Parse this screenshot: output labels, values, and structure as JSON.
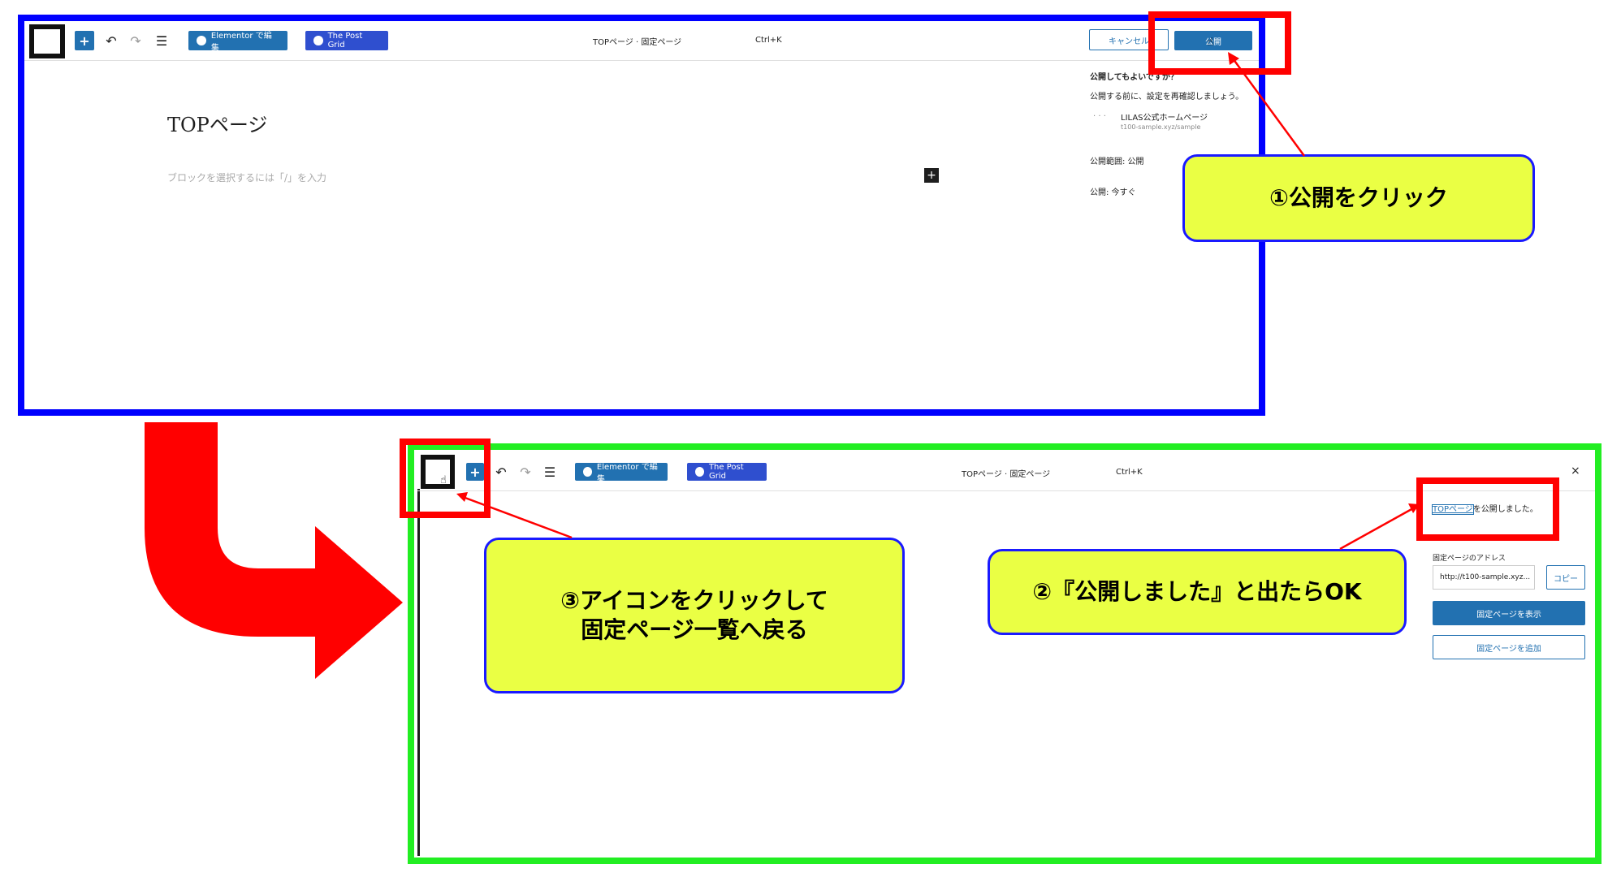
{
  "top_editor": {
    "elementor_label": "Elementor で編集",
    "postgrid_label": "The Post Grid",
    "doc_title": "TOPページ · 固定ページ",
    "shortcut": "Ctrl+K",
    "cancel_label": "キャンセル",
    "publish_label": "公開",
    "page_title": "TOPページ",
    "block_placeholder": "ブロックを選択するには「/」を入力",
    "panel_heading": "公開してもよいですか？",
    "panel_desc": "公開する前に、設定を再確認しましょう。",
    "site_name": "LILAS公式ホームページ",
    "site_url": "t100-sample.xyz/sample",
    "visibility": "公開範囲: 公開",
    "publish_time": "公開: 今すぐ"
  },
  "bottom_editor": {
    "elementor_label": "Elementor で編集",
    "postgrid_label": "The Post Grid",
    "doc_title": "TOPページ · 固定ページ",
    "shortcut": "Ctrl+K",
    "close_label": "×",
    "published_link": "TOPページ",
    "published_text": "を公開しました。",
    "address_label": "固定ページのアドレス",
    "address_value": "http://t100-sample.xyz...",
    "copy_label": "コピー",
    "view_label": "固定ページを表示",
    "add_label": "固定ページを追加"
  },
  "callouts": {
    "step1": "①公開をクリック",
    "step2": "②『公開しました』と出たらOK",
    "step3_line1": "③アイコンをクリックして",
    "step3_line2": "固定ページ一覧へ戻る"
  },
  "colors": {
    "top_frame": "#0000ff",
    "bottom_frame": "#00ee00",
    "highlight": "#ff0000",
    "callout_fill": "#eaff44",
    "wp_blue": "#2271b1"
  }
}
